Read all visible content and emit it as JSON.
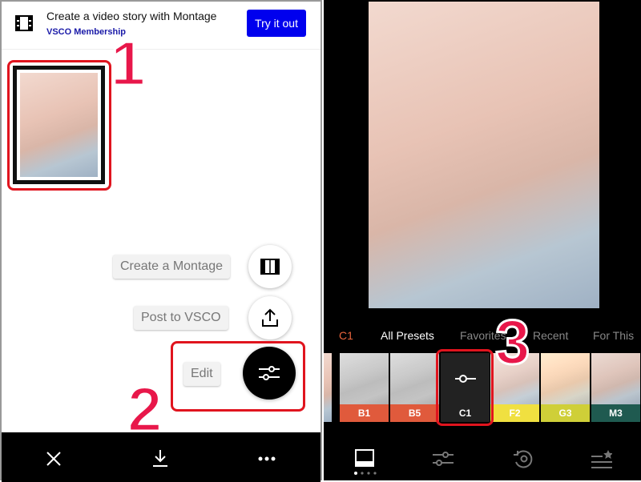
{
  "banner": {
    "title": "Create a video story with Montage",
    "subtitle": "VSCO Membership",
    "cta": "Try it out",
    "icon": "film-icon"
  },
  "actions": {
    "montage": "Create a Montage",
    "post": "Post to VSCO",
    "edit": "Edit"
  },
  "bottom_bar": {
    "icons": [
      "close-icon",
      "download-icon",
      "more-icon"
    ]
  },
  "steps": [
    "1",
    "2",
    "3"
  ],
  "editor": {
    "tabs": [
      {
        "label": "C1",
        "active_color": "#e8643c"
      },
      {
        "label": "All Presets"
      },
      {
        "label": "Favorites"
      },
      {
        "label": "Recent"
      },
      {
        "label": "For This"
      }
    ],
    "presets": [
      {
        "label": "B1",
        "color": "#e05a3c"
      },
      {
        "label": "B5",
        "color": "#e05a3c"
      },
      {
        "label": "C1",
        "color": "#222222",
        "selected": true
      },
      {
        "label": "F2",
        "color": "#f0e040"
      },
      {
        "label": "G3",
        "color": "#cfcf38"
      },
      {
        "label": "M3",
        "color": "#1f5a50"
      }
    ],
    "toolbar": [
      "presets-icon",
      "adjust-icon",
      "history-icon",
      "recipes-icon"
    ]
  },
  "colors": {
    "accent": "#0000ee",
    "annotation": "#e8174a"
  }
}
